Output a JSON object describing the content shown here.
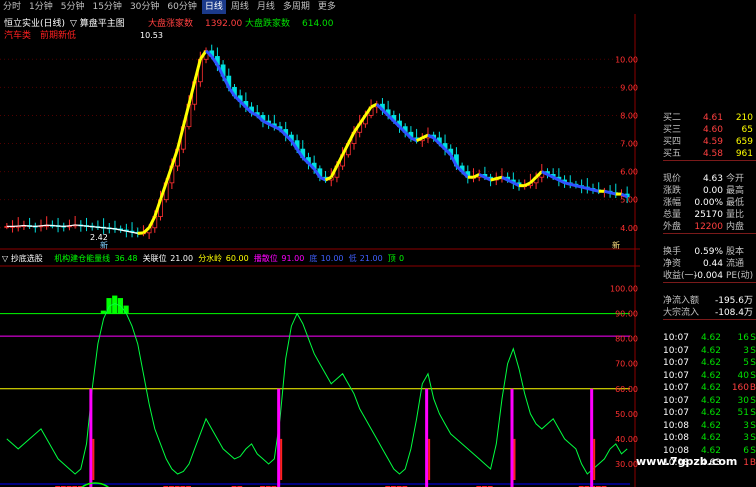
{
  "toolbar": {
    "tabs": [
      "分时",
      "1分钟",
      "5分钟",
      "15分钟",
      "30分钟",
      "60分钟",
      "日线",
      "周线",
      "月线",
      "多周期",
      "更多"
    ],
    "active": 6
  },
  "main_header": {
    "stock": "恒立实业(日线)",
    "template": "▽ 算盘平主图",
    "legend1": "大盘涨家数",
    "value1": "1392.00",
    "legend2": "大盘跌家数",
    "value2": "614.00"
  },
  "main_labels": {
    "l1": "汽车类",
    "l2": "前期新低"
  },
  "marks": {
    "high": "10.53",
    "low": "2.42",
    "low_marker": "新",
    "extra_marker": "新"
  },
  "price_axis": {
    "ticks": [
      "10.00",
      "9.00",
      "8.00",
      "7.00",
      "6.00",
      "5.00",
      "4.00"
    ]
  },
  "indicator_header": {
    "name": "▽ 抄底选股",
    "s1_name": "机构建仓能量线",
    "s1_val": "36.48",
    "s2_name": "关联位",
    "s2_val": "21.00",
    "s3_name": "分水岭",
    "s3_val": "60.00",
    "s4_name": "播散位",
    "s4_val": "91.00",
    "s5_name": "底",
    "s5_val": "10.00",
    "s6_name": "低",
    "s6_val": "21.00",
    "s7_name": "顶",
    "s7_val": "0"
  },
  "indicator_axis": {
    "ticks": [
      "100.00",
      "90.00",
      "80.00",
      "70.00",
      "60.00",
      "50.00",
      "40.00",
      "30.00"
    ]
  },
  "bottom_labels": [
    "抄底",
    "抄底",
    "抄底",
    "抄底"
  ],
  "quote_panel": {
    "asks": [
      {
        "label": "买二",
        "price": "4.61",
        "vol": "210"
      },
      {
        "label": "买三",
        "price": "4.60",
        "vol": "65"
      },
      {
        "label": "买四",
        "price": "4.59",
        "vol": "659"
      },
      {
        "label": "买五",
        "price": "4.58",
        "vol": "961"
      }
    ],
    "current": {
      "label": "现价",
      "val": "4.63",
      "label2": "今开"
    },
    "change": {
      "label": "涨跌",
      "val": "0.00",
      "label2": "最高"
    },
    "pct": {
      "label": "涨幅",
      "val": "0.00%",
      "label2": "最低"
    },
    "total": {
      "label": "总量",
      "val": "25170",
      "label2": "量比"
    },
    "outer": {
      "label": "外盘",
      "val": "12200",
      "label2": "内盘"
    },
    "turnover": {
      "label": "换手",
      "val": "0.59%",
      "label2": "股本"
    },
    "net": {
      "label": "净资",
      "val": "0.44",
      "label2": "流通"
    },
    "earn": {
      "label": "收益(一)",
      "val": "-0.004",
      "label2": "PE(动)"
    },
    "flow1": {
      "label": "净流入额",
      "val": "-195.6万"
    },
    "flow2": {
      "label": "大宗流入",
      "val": "-108.4万"
    },
    "ticks": [
      {
        "t": "10:07",
        "p": "4.62",
        "v": "16",
        "s": "S"
      },
      {
        "t": "10:07",
        "p": "4.62",
        "v": "3",
        "s": "S"
      },
      {
        "t": "10:07",
        "p": "4.62",
        "v": "5",
        "s": "S"
      },
      {
        "t": "10:07",
        "p": "4.62",
        "v": "40",
        "s": "S"
      },
      {
        "t": "10:07",
        "p": "4.62",
        "v": "160",
        "s": "B"
      },
      {
        "t": "10:07",
        "p": "4.62",
        "v": "30",
        "s": "S"
      },
      {
        "t": "10:07",
        "p": "4.62",
        "v": "51",
        "s": "S"
      },
      {
        "t": "10:08",
        "p": "4.62",
        "v": "3",
        "s": "S"
      },
      {
        "t": "10:08",
        "p": "4.62",
        "v": "3",
        "s": "S"
      },
      {
        "t": "10:08",
        "p": "4.62",
        "v": "6",
        "s": "S"
      },
      {
        "t": "10:08",
        "p": "4.63",
        "v": "1",
        "s": "B"
      }
    ]
  },
  "watermark": "www.7gpzb.com",
  "chart_data": {
    "type": "line",
    "price_ylim": [
      3.6,
      10.9
    ],
    "closes": [
      4.05,
      4.05,
      4.06,
      4.08,
      4.06,
      4.05,
      4.07,
      4.09,
      4.08,
      4.06,
      4.05,
      4.07,
      4.1,
      4.08,
      4.06,
      4.04,
      4.02,
      4.0,
      3.98,
      3.96,
      3.92,
      3.88,
      3.84,
      3.8,
      3.82,
      4.0,
      4.4,
      5.0,
      5.6,
      6.2,
      6.8,
      7.6,
      8.4,
      9.2,
      10.0,
      10.3,
      10.1,
      9.8,
      9.4,
      9.0,
      8.7,
      8.5,
      8.3,
      8.1,
      8.0,
      7.8,
      7.7,
      7.6,
      7.5,
      7.3,
      7.1,
      6.8,
      6.5,
      6.3,
      6.1,
      5.8,
      5.7,
      5.8,
      6.2,
      6.6,
      7.0,
      7.4,
      7.7,
      8.0,
      8.3,
      8.4,
      8.2,
      8.0,
      7.8,
      7.6,
      7.4,
      7.2,
      7.1,
      7.2,
      7.3,
      7.2,
      7.0,
      6.8,
      6.6,
      6.2,
      6.0,
      5.8,
      5.8,
      5.9,
      5.8,
      5.7,
      5.75,
      5.8,
      5.7,
      5.6,
      5.5,
      5.5,
      5.6,
      5.8,
      6.0,
      5.9,
      5.8,
      5.7,
      5.6,
      5.55,
      5.5,
      5.45,
      5.4,
      5.35,
      5.3,
      5.3,
      5.25,
      5.2,
      5.2,
      5.1
    ],
    "indicator_ylim": [
      22,
      105
    ],
    "energy": [
      40,
      38,
      36,
      38,
      40,
      42,
      44,
      40,
      36,
      32,
      30,
      28,
      26,
      28,
      38,
      60,
      78,
      88,
      93,
      94,
      93,
      90,
      85,
      78,
      66,
      54,
      44,
      38,
      32,
      28,
      26,
      27,
      30,
      36,
      42,
      48,
      44,
      40,
      36,
      34,
      32,
      33,
      36,
      38,
      34,
      32,
      30,
      32,
      48,
      72,
      85,
      90,
      86,
      80,
      74,
      70,
      66,
      62,
      64,
      66,
      62,
      58,
      52,
      48,
      44,
      40,
      36,
      32,
      28,
      26,
      28,
      36,
      48,
      62,
      66,
      56,
      50,
      46,
      42,
      40,
      38,
      36,
      34,
      32,
      30,
      28,
      38,
      56,
      70,
      76,
      68,
      58,
      50,
      46,
      44,
      46,
      48,
      44,
      40,
      38,
      36,
      30,
      26,
      28,
      30,
      32,
      36,
      38,
      34,
      36
    ],
    "hlines": [
      {
        "v": 90,
        "color": "#00ff00"
      },
      {
        "v": 81,
        "color": "#ff00ff"
      },
      {
        "v": 60,
        "color": "#ffff00"
      },
      {
        "v": 22,
        "color": "#0000ff"
      }
    ],
    "signals": [
      15,
      48,
      74,
      89,
      103
    ]
  }
}
